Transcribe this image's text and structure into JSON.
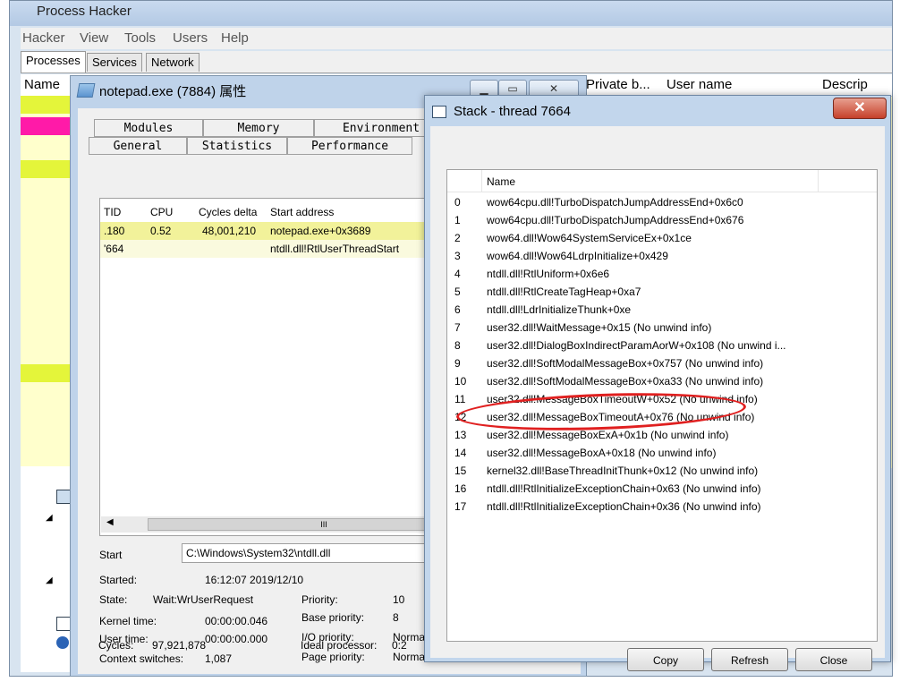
{
  "main": {
    "title": "Process Hacker",
    "menu": [
      "Hacker",
      "View",
      "Tools",
      "Users",
      "Help"
    ],
    "tabs": [
      "Processes",
      "Services",
      "Network"
    ],
    "columns": [
      "Name",
      "Private b...",
      "User name",
      "Descrip"
    ]
  },
  "props": {
    "title": "notepad.exe (7884) 属性",
    "tabs_row1": [
      "Modules",
      "Memory",
      "Environment"
    ],
    "tabs_row2": [
      "General",
      "Statistics",
      "Performance"
    ],
    "threads": {
      "columns": [
        "TID",
        "CPU",
        "Cycles delta",
        "Start address"
      ],
      "rows": [
        {
          "tid": ".180",
          "cpu": "0.52",
          "cycles": "48,001,210",
          "start": "notepad.exe+0x3689"
        },
        {
          "tid": "'664",
          "cpu": "",
          "cycles": "",
          "start": "ntdll.dll!RtlUserThreadStart"
        }
      ],
      "scroll_glyph": "III"
    },
    "start_label": "Start",
    "start_value": "C:\\Windows\\System32\\ntdll.dll",
    "info": {
      "started_label": "Started:",
      "started_value": "16:12:07 2019/12/10",
      "state_label": "State:",
      "state_value": "Wait:WrUserRequest",
      "priority_label": "Priority:",
      "priority_value": "10",
      "kernel_label": "Kernel time:",
      "kernel_value": "00:00:00.046",
      "base_priority_label": "Base priority:",
      "base_priority_value": "8",
      "user_label": "User time:",
      "user_value": "00:00:00.000",
      "io_priority_label": "I/O priority:",
      "io_priority_value": "Norma",
      "ctx_label": "Context switches:",
      "ctx_value": "1,087",
      "page_priority_label": "Page priority:",
      "page_priority_value": "Norma",
      "cycles_label": "Cycles:",
      "cycles_value": "97,921,878",
      "ideal_label": "Ideal processor:",
      "ideal_value": "0:2"
    }
  },
  "stack": {
    "title": "Stack - thread 7664",
    "column": "Name",
    "frames": [
      {
        "n": "0",
        "name": "wow64cpu.dll!TurboDispatchJumpAddressEnd+0x6c0"
      },
      {
        "n": "1",
        "name": "wow64cpu.dll!TurboDispatchJumpAddressEnd+0x676"
      },
      {
        "n": "2",
        "name": "wow64.dll!Wow64SystemServiceEx+0x1ce"
      },
      {
        "n": "3",
        "name": "wow64.dll!Wow64LdrpInitialize+0x429"
      },
      {
        "n": "4",
        "name": "ntdll.dll!RtlUniform+0x6e6"
      },
      {
        "n": "5",
        "name": "ntdll.dll!RtlCreateTagHeap+0xa7"
      },
      {
        "n": "6",
        "name": "ntdll.dll!LdrInitializeThunk+0xe"
      },
      {
        "n": "7",
        "name": "user32.dll!WaitMessage+0x15 (No unwind info)"
      },
      {
        "n": "8",
        "name": "user32.dll!DialogBoxIndirectParamAorW+0x108 (No unwind i..."
      },
      {
        "n": "9",
        "name": "user32.dll!SoftModalMessageBox+0x757 (No unwind info)"
      },
      {
        "n": "10",
        "name": "user32.dll!SoftModalMessageBox+0xa33 (No unwind info)"
      },
      {
        "n": "11",
        "name": "user32.dll!MessageBoxTimeoutW+0x52 (No unwind info)"
      },
      {
        "n": "12",
        "name": "user32.dll!MessageBoxTimeoutA+0x76 (No unwind info)"
      },
      {
        "n": "13",
        "name": "user32.dll!MessageBoxExA+0x1b (No unwind info)"
      },
      {
        "n": "14",
        "name": "user32.dll!MessageBoxA+0x18 (No unwind info)"
      },
      {
        "n": "15",
        "name": "kernel32.dll!BaseThreadInitThunk+0x12 (No unwind info)"
      },
      {
        "n": "16",
        "name": "ntdll.dll!RtlInitializeExceptionChain+0x63 (No unwind info)"
      },
      {
        "n": "17",
        "name": "ntdll.dll!RtlInitializeExceptionChain+0x36 (No unwind info)"
      }
    ],
    "buttons": {
      "copy": "Copy",
      "refresh": "Refresh",
      "close": "Close"
    },
    "close_glyph": "✕"
  },
  "colors": {
    "row_yellow": "#f2f29a",
    "row_magenta": "#ff1aa8",
    "row_lime": "#e4f53a",
    "annotation": "#e02020"
  },
  "icons": [
    "notepad-icon",
    "window-icon",
    "minimize-icon",
    "maximize-icon",
    "close-icon",
    "tree-expand-icon",
    "help-icon"
  ]
}
